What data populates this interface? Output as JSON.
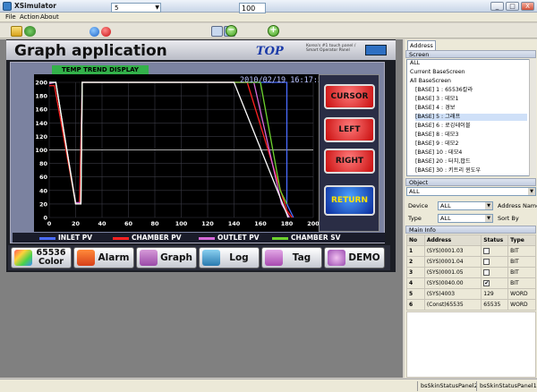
{
  "window": {
    "title": "XSimulator",
    "min": "_",
    "max": "□",
    "close": "X"
  },
  "menu": [
    "File",
    "Action",
    "About"
  ],
  "toolbar": {
    "screen_select": "5",
    "zoom": "100",
    "zoom_out": "−",
    "zoom_in": "+"
  },
  "hmi": {
    "title": "Graph application",
    "logo": "TOP",
    "logo_tagline": "Korea's #1 touch panel / Smart Operator Panel",
    "chart_title": "TEMP TREND DISPLAY",
    "datetime": "2010/02/19  16:17:50",
    "side_buttons": [
      "CURSOR",
      "LEFT",
      "RIGHT",
      "RETURN"
    ],
    "legend": [
      "INLET PV",
      "CHAMBER PV",
      "OUTLET PV",
      "CHAMBER SV"
    ],
    "legend_colors": [
      "#4a6cff",
      "#ff2222",
      "#d66ad9",
      "#6dd22e"
    ],
    "nav_buttons": [
      {
        "label": "65536 Color",
        "icon": "palette-icon"
      },
      {
        "label": "Alarm",
        "icon": "alarm-icon"
      },
      {
        "label": "Graph",
        "icon": "graph-icon"
      },
      {
        "label": "Log",
        "icon": "log-icon"
      },
      {
        "label": "Tag",
        "icon": "tag-icon"
      },
      {
        "label": "DEMO",
        "icon": "demo-icon"
      }
    ]
  },
  "chart_data": {
    "type": "line",
    "title": "TEMP TREND DISPLAY",
    "xlim": [
      0,
      200
    ],
    "ylim": [
      0,
      200
    ],
    "xticks": [
      0,
      20,
      40,
      60,
      80,
      100,
      120,
      140,
      160,
      180,
      200
    ],
    "yticks": [
      0,
      20,
      40,
      60,
      80,
      100,
      120,
      140,
      160,
      180,
      200
    ],
    "grid": true,
    "series": [
      {
        "name": "INLET PV",
        "color": "#4a6cff",
        "points": [
          [
            0,
            200
          ],
          [
            5,
            200
          ],
          [
            20,
            20
          ],
          [
            23,
            20
          ],
          [
            25,
            200
          ],
          [
            180,
            200
          ],
          [
            180,
            20
          ],
          [
            185,
            0
          ]
        ]
      },
      {
        "name": "CHAMBER PV",
        "color": "#ff2222",
        "points": [
          [
            0,
            195
          ],
          [
            4,
            195
          ],
          [
            20,
            20
          ],
          [
            23,
            20
          ],
          [
            25,
            200
          ],
          [
            150,
            200
          ],
          [
            180,
            10
          ],
          [
            184,
            0
          ]
        ]
      },
      {
        "name": "OUTLET PV",
        "color": "#d66ad9",
        "points": [
          [
            0,
            198
          ],
          [
            5,
            200
          ],
          [
            20,
            22
          ],
          [
            24,
            22
          ],
          [
            25,
            200
          ],
          [
            155,
            200
          ],
          [
            176,
            20
          ],
          [
            182,
            0
          ]
        ]
      },
      {
        "name": "CHAMBER SV",
        "color": "#6dd22e",
        "points": [
          [
            0,
            200
          ],
          [
            5,
            200
          ],
          [
            20,
            20
          ],
          [
            24,
            20
          ],
          [
            25,
            200
          ],
          [
            160,
            200
          ],
          [
            175,
            40
          ],
          [
            180,
            20
          ]
        ]
      },
      {
        "name": "",
        "color": "#ffffff",
        "points": [
          [
            0,
            200
          ],
          [
            5,
            200
          ],
          [
            20,
            20
          ],
          [
            24,
            20
          ],
          [
            25,
            200
          ],
          [
            140,
            200
          ],
          [
            181,
            0
          ]
        ]
      }
    ]
  },
  "right_panel": {
    "tab": "Address",
    "screen_header": "Screen",
    "screen_items": [
      "ALL",
      "Current BaseScreen",
      "All BaseScreen",
      "[BASE] 1 : 65536칼라",
      "[BASE] 3 : 데모1",
      "[BASE] 4 : 경보",
      "[BASE] 5 : 그래프",
      "[BASE] 6 : 로깅테이블",
      "[BASE] 8 : 데모3",
      "[BASE] 9 : 데모2",
      "[BASE] 10 : 데모4",
      "[BASE] 20 : 터치,팝드",
      "[BASE] 30 : 키트리 윈도우"
    ],
    "object_header": "Object",
    "object_value": "ALL",
    "device_label": "Device",
    "device_value": "ALL",
    "address_name_label": "Address Name",
    "type_label": "Type",
    "type_value": "ALL",
    "sort_label": "Sort By",
    "main_info_header": "Main Info",
    "table_headers": [
      "No",
      "Address",
      "Status",
      "Type"
    ],
    "table_rows": [
      {
        "no": "1",
        "address": "(SYS)0001.03",
        "status": "",
        "type": "BIT"
      },
      {
        "no": "2",
        "address": "(SYS)0001.04",
        "status": "",
        "type": "BIT"
      },
      {
        "no": "3",
        "address": "(SYS)0001.05",
        "status": "",
        "type": "BIT"
      },
      {
        "no": "4",
        "address": "(SYS)0040.00",
        "status": "✔",
        "type": "BIT"
      },
      {
        "no": "5",
        "address": "(SYS)4003",
        "status": "129",
        "type": "WORD"
      },
      {
        "no": "6",
        "address": "(Const)65535",
        "status": "65535",
        "type": "WORD"
      }
    ]
  },
  "statusbar": [
    "bsSkinStatusPanel2",
    "bsSkinStatusPanel1"
  ]
}
